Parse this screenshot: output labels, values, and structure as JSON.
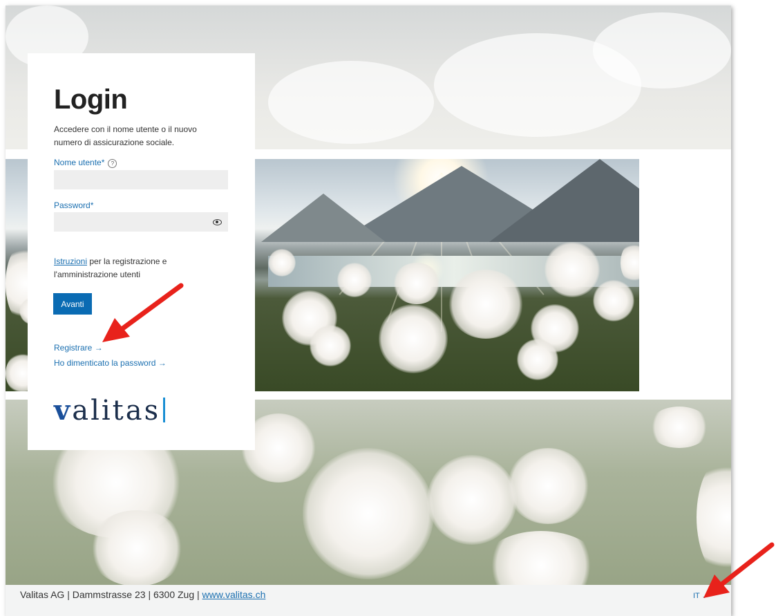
{
  "login": {
    "title": "Login",
    "subtitle": "Accedere con il nome utente o il nuovo numero di assicurazione sociale.",
    "username_label": "Nome utente*",
    "username_value": "",
    "password_label": "Password*",
    "password_value": "",
    "instructions_link": "Istruzioni",
    "instructions_text": " per la registrazione e l'amministrazione utenti",
    "submit_label": "Avanti",
    "register_link": "Registrare →",
    "forgot_link": "Ho dimenticato la password →",
    "logo_first": "v",
    "logo_rest": "alitas"
  },
  "footer": {
    "company": "Valitas AG | Dammstrasse 23 | 6300 Zug | ",
    "website": "www.valitas.ch",
    "language": "IT"
  },
  "icons": {
    "help": "question-circle-icon",
    "password_toggle": "eye-icon",
    "language_dropdown": "chevron-down-icon"
  },
  "colors": {
    "accent": "#0a6bb3",
    "link": "#1a6fb0",
    "annotation": "#e8221b"
  }
}
